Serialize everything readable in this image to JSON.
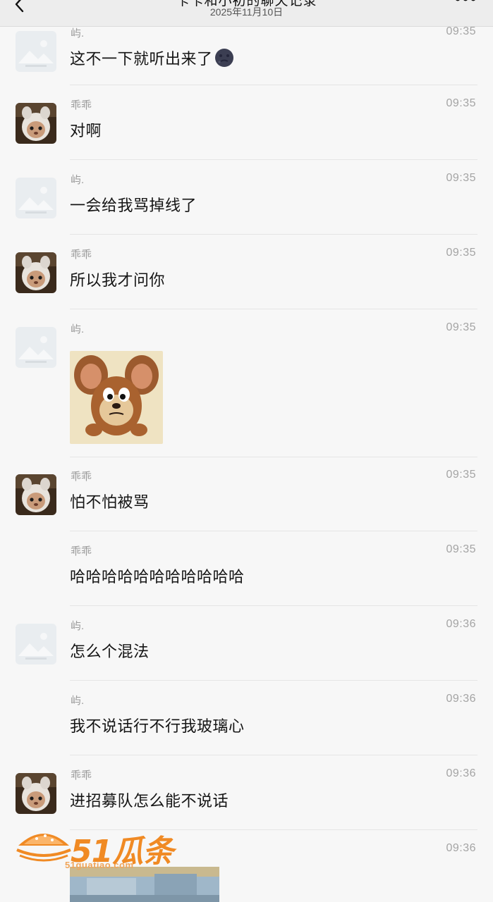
{
  "header": {
    "title_cut": "卡卡和小初的聊天记录",
    "date": "2025年11月10日"
  },
  "messages": [
    {
      "sender": "屿.",
      "time": "09:35",
      "text": "这不一下就听出来了",
      "avatar": "placeholder",
      "emoji": "dark-moon-face"
    },
    {
      "sender": "乖乖",
      "time": "09:35",
      "text": "对啊",
      "avatar": "mouse"
    },
    {
      "sender": "屿.",
      "time": "09:35",
      "text": "一会给我骂掉线了",
      "avatar": "placeholder"
    },
    {
      "sender": "乖乖",
      "time": "09:35",
      "text": "所以我才问你",
      "avatar": "mouse"
    },
    {
      "sender": "屿.",
      "time": "09:35",
      "text": "",
      "avatar": "placeholder",
      "sticker": "jerry-mouse-sticker"
    },
    {
      "sender": "乖乖",
      "time": "09:35",
      "text": "怕不怕被骂",
      "avatar": "mouse"
    },
    {
      "sender": "乖乖",
      "time": "09:35",
      "text": "哈哈哈哈哈哈哈哈哈哈哈",
      "avatar": "none"
    },
    {
      "sender": "屿.",
      "time": "09:36",
      "text": "怎么个混法",
      "avatar": "placeholder"
    },
    {
      "sender": "屿.",
      "time": "09:36",
      "text": "我不说话行不行我玻璃心",
      "avatar": "none"
    },
    {
      "sender": "乖乖",
      "time": "09:36",
      "text": "进招募队怎么能不说话",
      "avatar": "mouse"
    },
    {
      "sender": "",
      "time": "09:36",
      "text": "",
      "avatar": "none",
      "sticker": "cartoon-room-image"
    }
  ],
  "watermark": {
    "brand": "51瓜条",
    "url": "51guatiao.com"
  },
  "colors": {
    "background": "#f7f7f7",
    "header": "#ededed",
    "watermark": "#f08a24"
  }
}
